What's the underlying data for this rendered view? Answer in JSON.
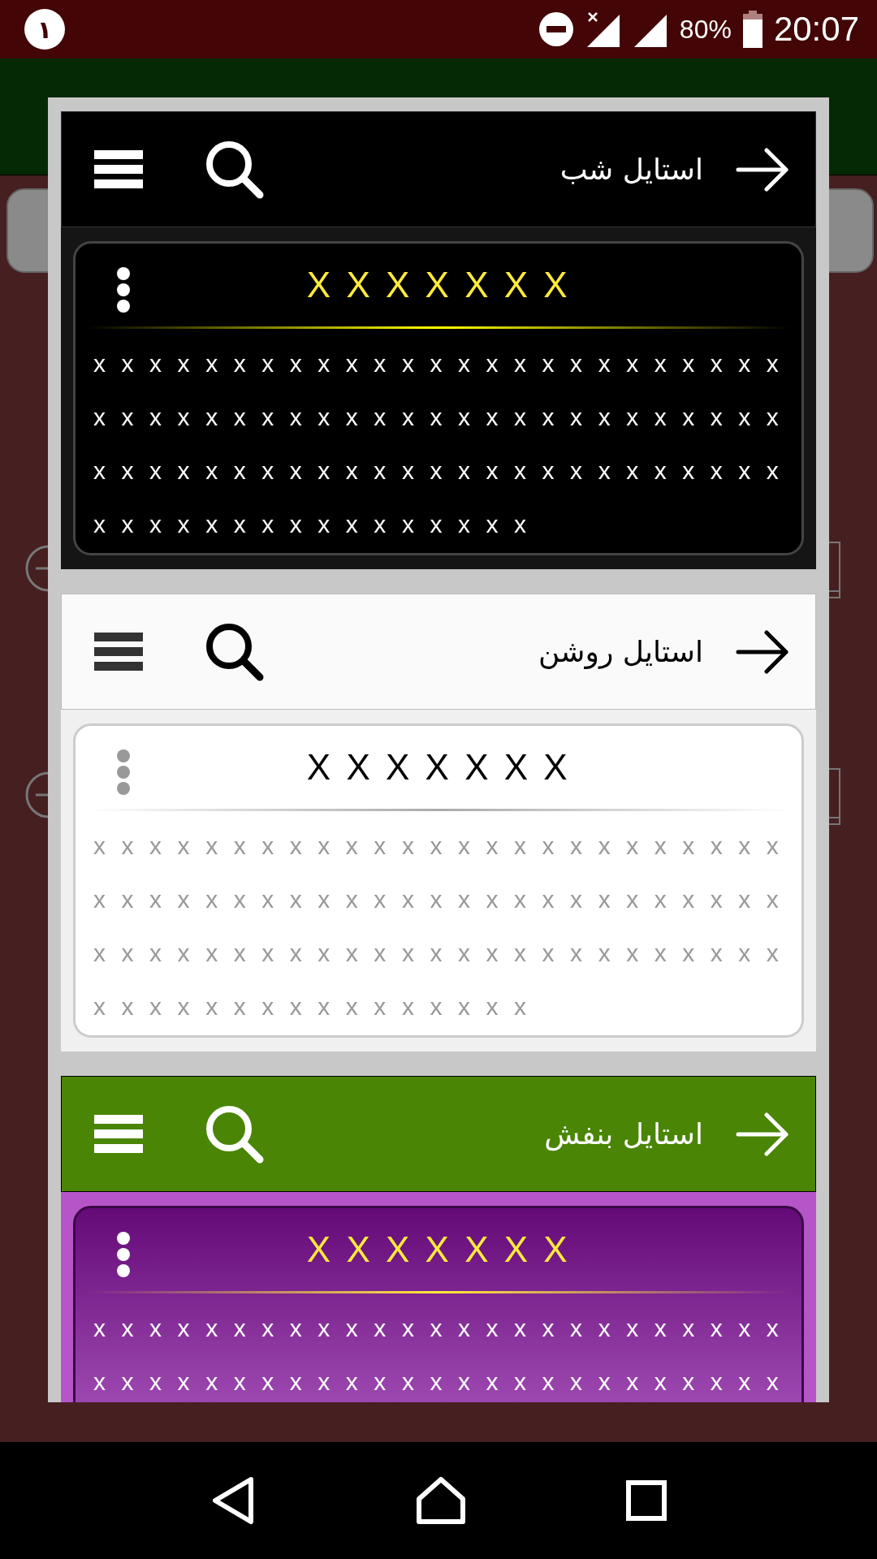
{
  "status_bar": {
    "notification": "١",
    "battery": "80%",
    "time": "20:07"
  },
  "styles": [
    {
      "kind": "dark",
      "title": "استایل شب",
      "card_title": "X X X X X X X",
      "lines": [
        "x x x x x x x x x x x x x x x x x x x x x x x x x",
        "x x x x x x x x x x x x x x x x x x x x x x x x x",
        "x x x x x x x x x x x x x x x x x x x x x x x x x",
        "x x x x x x x x x x x x x x x x"
      ]
    },
    {
      "kind": "light",
      "title": "استایل روشن",
      "card_title": "X X X X X X X",
      "lines": [
        "x x x x x x x x x x x x x x x x x x x x x x x x x",
        "x x x x x x x x x x x x x x x x x x x x x x x x x",
        "x x x x x x x x x x x x x x x x x x x x x x x x x",
        "x x x x x x x x x x x x x x x x"
      ]
    },
    {
      "kind": "purple",
      "title": "استایل بنفش",
      "card_title": "X X X X X X X",
      "lines": [
        "x x x x x x x x x x x x x x x x x x x x x x x x x",
        "x x x x x x x x x x x x x x x x x x x x x x x x x"
      ]
    }
  ]
}
